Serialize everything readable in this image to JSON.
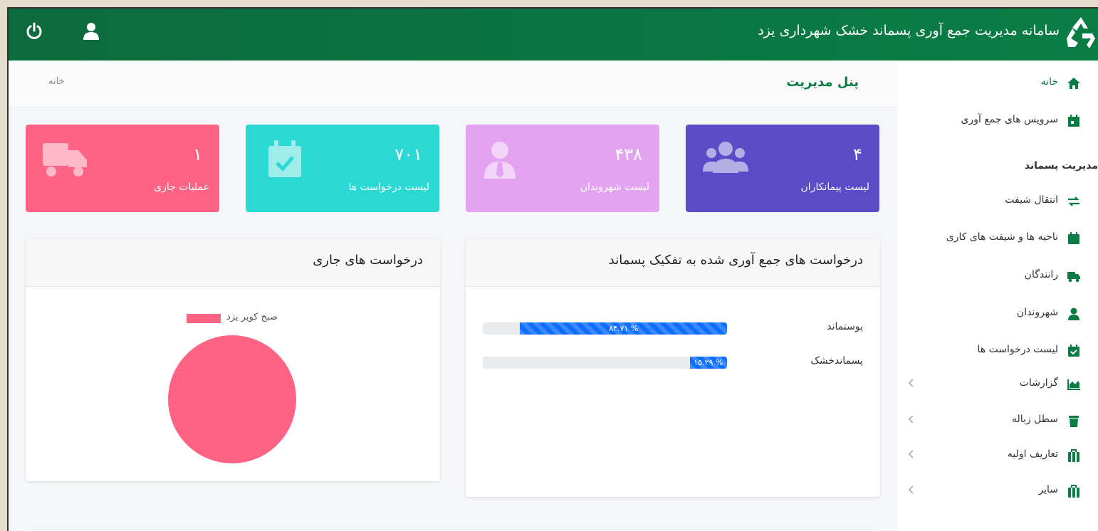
{
  "header": {
    "title": "سامانه مدیریت جمع آوری پسماند خشک شهرداری یزد"
  },
  "page": {
    "title": "پنل مدیریت",
    "breadcrumb": "خانه"
  },
  "sidebar": {
    "items": [
      {
        "label": "خانه",
        "icon": "home-icon"
      },
      {
        "label": "سرویس های جمع آوری",
        "icon": "calendar-icon"
      },
      {
        "label": "انتقال شیفت",
        "icon": "exchange-icon"
      },
      {
        "label": "ناحیه ها و شیفت های کاری",
        "icon": "calendar-icon"
      },
      {
        "label": "رانندگان",
        "icon": "truck-icon"
      },
      {
        "label": "شهروندان",
        "icon": "user-icon"
      },
      {
        "label": "لیست درخواست ها",
        "icon": "calendar-check-icon"
      },
      {
        "label": "گزارشات",
        "icon": "chart-area-icon"
      },
      {
        "label": "سطل زباله",
        "icon": "trash-icon"
      },
      {
        "label": "تعاریف اولیه",
        "icon": "briefcase-icon"
      },
      {
        "label": "سایر",
        "icon": "briefcase-icon"
      }
    ],
    "section_header": "مدیریت پسماند"
  },
  "stats": [
    {
      "value": "۱",
      "label": "عملیات جاری",
      "color": "#ff6384",
      "icon": "truck-icon"
    },
    {
      "value": "۷۰۱",
      "label": "لیست درخواست ها",
      "color": "#2ad8d4",
      "icon": "calendar-check-icon"
    },
    {
      "value": "۴۳۸",
      "label": "لیست شهروندان",
      "color": "#e4a3f0",
      "icon": "user-tie-icon"
    },
    {
      "value": "۴",
      "label": "لیست پیمانکاران",
      "color": "#5c4bc7",
      "icon": "users-icon"
    }
  ],
  "waste_card": {
    "title": "درخواست های جمع آوری شده به تفکیک پسماند",
    "rows": [
      {
        "label": "پوستماند",
        "percent_text": "% ۸۴.۷۱",
        "fraction": 0.8471
      },
      {
        "label": "پسماندخشک",
        "percent_text": "% ۱۵.۲۹",
        "fraction": 0.1529
      }
    ]
  },
  "current_card": {
    "title": "درخواست های جاری"
  },
  "chart_data": {
    "type": "pie",
    "labels": [
      "صبح کویر یزد"
    ],
    "values": [
      1
    ],
    "colors": [
      "#ff6384"
    ],
    "legend": "top"
  },
  "colors": {
    "brand_green": "#0a7d45",
    "progress_blue": "#0d6efd"
  }
}
